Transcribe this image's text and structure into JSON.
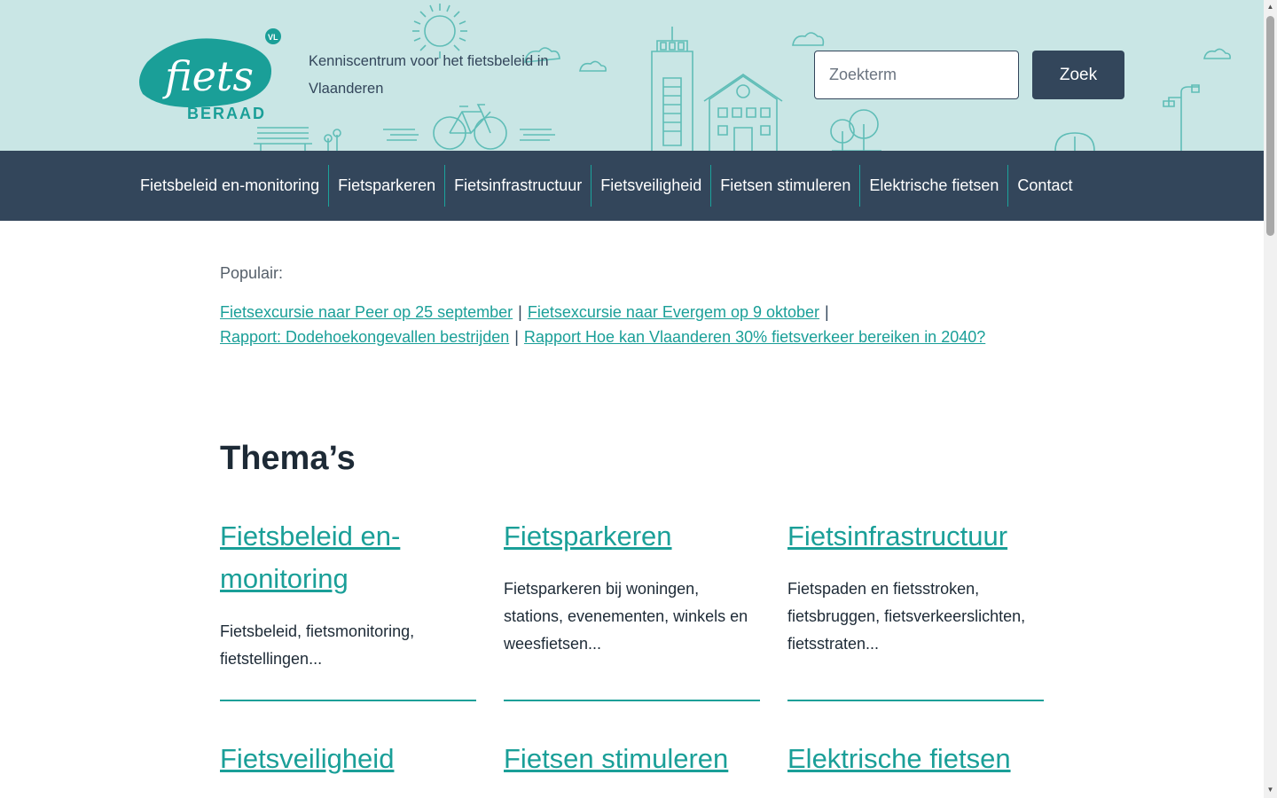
{
  "header": {
    "logo_text": "fiets",
    "logo_sub": "BERAAD",
    "logo_badge": "VL",
    "tagline": "Kenniscentrum voor het fietsbeleid in Vlaanderen",
    "search_placeholder": "Zoekterm",
    "search_button": "Zoek"
  },
  "nav": {
    "items": [
      "Fietsbeleid en-monitoring",
      "Fietsparkeren",
      "Fietsinfrastructuur",
      "Fietsveiligheid",
      "Fietsen stimuleren",
      "Elektrische fietsen",
      "Contact"
    ]
  },
  "popular": {
    "label": "Populair:",
    "links": [
      "Fietsexcursie naar Peer op 25 september",
      "Fietsexcursie naar Evergem op 9 oktober",
      "Rapport: Dodehoekongevallen bestrijden",
      "Rapport Hoe kan Vlaanderen 30% fietsverkeer bereiken in 2040?"
    ],
    "separator": "|"
  },
  "themes": {
    "title": "Thema’s",
    "cards": [
      {
        "title": "Fietsbeleid en-monitoring",
        "desc": "Fietsbeleid, fietsmonitoring, fietstellingen..."
      },
      {
        "title": "Fietsparkeren",
        "desc": "Fietsparkeren bij woningen, stations, evenementen, winkels en weesfietsen..."
      },
      {
        "title": "Fietsinfrastructuur",
        "desc": "Fietspaden en fietsstroken, fietsbruggen, fietsverkeerslichten, fietsstraten..."
      },
      {
        "title": "Fietsveiligheid",
        "desc": ""
      },
      {
        "title": "Fietsen stimuleren",
        "desc": ""
      },
      {
        "title": "Elektrische fietsen",
        "desc": ""
      }
    ]
  },
  "colors": {
    "header_bg": "#c9e6e5",
    "nav_bg": "#33465b",
    "accent": "#1a9f98"
  }
}
